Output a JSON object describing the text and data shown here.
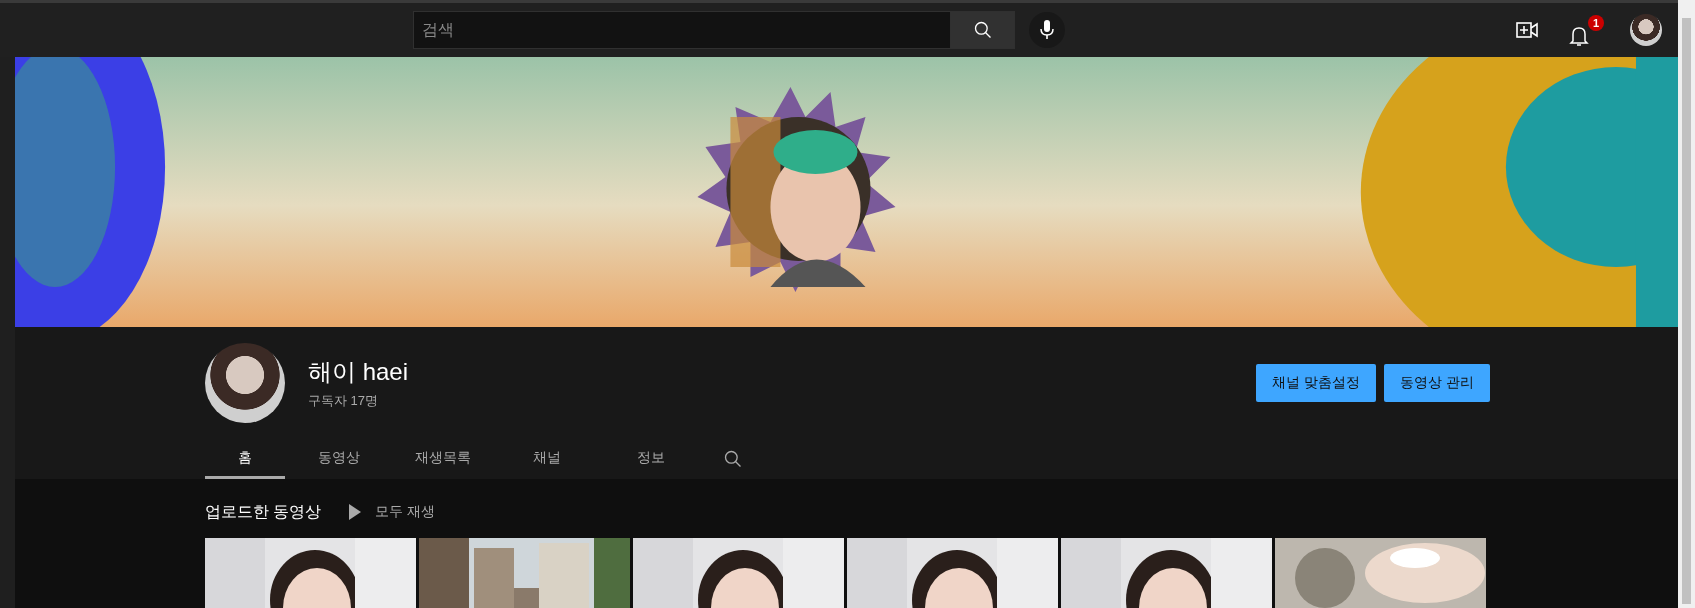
{
  "search": {
    "placeholder": "검색"
  },
  "notifications": {
    "count": "1"
  },
  "channel": {
    "name": "해이 haei",
    "subscribers": "구독자 17명"
  },
  "buttons": [
    "채널 맞춤설정",
    "동영상 관리"
  ],
  "tabs": [
    {
      "label": "홈",
      "selected": true
    },
    {
      "label": "동영상",
      "selected": false
    },
    {
      "label": "재생목록",
      "selected": false
    },
    {
      "label": "채널",
      "selected": false
    },
    {
      "label": "정보",
      "selected": false
    }
  ],
  "section": {
    "title": "업로드한 동영상",
    "play_all": "모두 재생"
  }
}
